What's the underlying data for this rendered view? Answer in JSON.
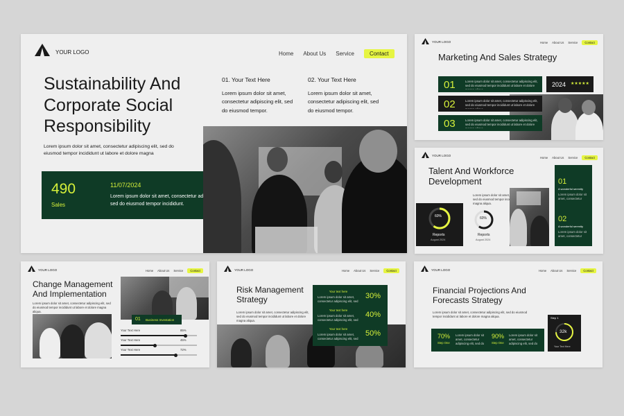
{
  "main": {
    "logo_text": "YOUR LOGO",
    "nav": [
      "Home",
      "About Us",
      "Service"
    ],
    "contact": "Contact",
    "title": "Sustainability And Corporate Social Responsibility",
    "col1_title": "01. Your Text Here",
    "col1_body": "Lorem ipsum dolor sit amet, consectetur adipiscing elit, sed do eiusmod tempor.",
    "col2_title": "02. Your Text Here",
    "col2_body": "Lorem ipsum dolor sit amet, consectetur adipiscing elit, sed do eiusmod tempor.",
    "intro": "Lorem ipsum dolor sit amet, consectetur adipiscing elit, sed do eiusmod tempor incididunt ut labore et dolore magna",
    "stat_value": "490",
    "stat_label": "Sales",
    "stat_date": "11/07/2024",
    "stat_body": "Lorem ipsum dolor sit amet, consectetur adipiscing elit, sed do eiusmod tempor incididunt."
  },
  "marketing": {
    "logo_text": "YOUR LOGO",
    "nav": [
      "Home",
      "About Us",
      "Service"
    ],
    "contact": "Contact",
    "title": "Marketing And Sales Strategy",
    "items": [
      "01",
      "02",
      "03"
    ],
    "year": "2024",
    "stars": "★★★★★"
  },
  "talent": {
    "logo_text": "YOUR LOGO",
    "nav": [
      "Home",
      "About Us",
      "Service"
    ],
    "contact": "Contact",
    "title": "Talent And Workforce Development",
    "gauge1": "60%",
    "gauge1_label": "Reports",
    "gauge1_sub": "August 2024",
    "gauge2": "60%",
    "gauge2_label": "Reports",
    "gauge2_sub": "August 2024",
    "side1_num": "01",
    "side1_title": "A wonderful serenity",
    "side2_num": "02",
    "side2_title": "A wonderful serenity"
  },
  "change": {
    "logo_text": "YOUR LOGO",
    "nav": [
      "Home",
      "About Us",
      "Service"
    ],
    "contact": "Contact",
    "title": "Change Management And Implementation",
    "badge_num": "01",
    "badge_text": "Business Investation",
    "bars": [
      {
        "label": "Your Text Here",
        "pct": "85%",
        "value": 0.85
      },
      {
        "label": "Your Text Here",
        "pct": "45%",
        "value": 0.45
      },
      {
        "label": "Your Text Here",
        "pct": "72%",
        "value": 0.72
      }
    ]
  },
  "risk": {
    "logo_text": "YOUR LOGO",
    "nav": [
      "Home",
      "About Us",
      "Service"
    ],
    "contact": "Contact",
    "title": "Risk Management Strategy",
    "rows": [
      {
        "label": "Your text here",
        "pct": "30%"
      },
      {
        "label": "Your text here",
        "pct": "40%"
      },
      {
        "label": "Your text here",
        "pct": "50%"
      }
    ]
  },
  "finance": {
    "logo_text": "YOUR LOGO",
    "nav": [
      "Home",
      "About Us",
      "Service"
    ],
    "contact": "Contact",
    "title": "Financial Projections And Forecasts Strategy",
    "stat1": "70%",
    "stat1_label": "Step One",
    "stat2": "90%",
    "stat2_label": "Step One",
    "card_label": "Step 1",
    "card_value": "32k",
    "card_sub": "Your Text Here"
  },
  "lorem": "Lorem ipsum dolor sit amet, consectetur adipiscing elit, sed do eiusmod tempor incididunt ut labore et dolore magna aliqua."
}
